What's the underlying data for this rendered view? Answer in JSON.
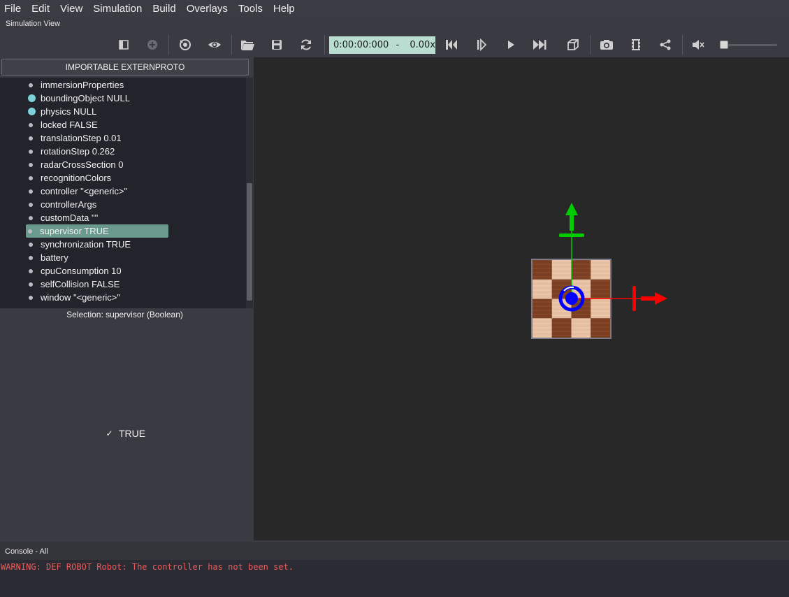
{
  "menu": {
    "items": [
      "File",
      "Edit",
      "View",
      "Simulation",
      "Build",
      "Overlays",
      "Tools",
      "Help"
    ]
  },
  "panel_title": "Simulation View",
  "toolbar": {
    "time": "0:00:00:000",
    "speed_separator": "-",
    "speed": "0.00x",
    "icons": [
      "toggle-panel-icon",
      "add-node-icon",
      "reset-view-icon",
      "eye-icon",
      "open-folder-icon",
      "save-icon",
      "reload-icon",
      "step-back-icon",
      "step-icon",
      "play-icon",
      "fast-forward-icon",
      "cube-view-icon",
      "screenshot-icon",
      "movie-icon",
      "share-icon",
      "mute-icon"
    ],
    "volume_level": 0.0
  },
  "scene_tree": {
    "importable_button": "IMPORTABLE EXTERNPROTO",
    "rows": [
      {
        "label": "immersionProperties",
        "type": "field"
      },
      {
        "label": "boundingObject NULL",
        "type": "node"
      },
      {
        "label": "physics NULL",
        "type": "node"
      },
      {
        "label": "locked FALSE",
        "type": "field"
      },
      {
        "label": "translationStep 0.01",
        "type": "field"
      },
      {
        "label": "rotationStep 0.262",
        "type": "field"
      },
      {
        "label": "radarCrossSection 0",
        "type": "field"
      },
      {
        "label": "recognitionColors",
        "type": "field"
      },
      {
        "label": "controller \"<generic>\"",
        "type": "field"
      },
      {
        "label": "controllerArgs",
        "type": "field"
      },
      {
        "label": "customData \"\"",
        "type": "field"
      },
      {
        "label": "supervisor TRUE",
        "type": "field",
        "selected": true
      },
      {
        "label": "synchronization TRUE",
        "type": "field"
      },
      {
        "label": "battery",
        "type": "field"
      },
      {
        "label": "cpuConsumption 10",
        "type": "field"
      },
      {
        "label": "selfCollision FALSE",
        "type": "field"
      },
      {
        "label": "window \"<generic>\"",
        "type": "field"
      }
    ]
  },
  "field_editor": {
    "selection": "Selection: supervisor (Boolean)",
    "checkbox_mark": "✓",
    "checkbox_label": "TRUE"
  },
  "console": {
    "title": "Console - All",
    "lines": [
      "WARNING: DEF ROBOT Robot: The controller has not been set."
    ]
  },
  "colors": {
    "accent_selected": "#6a9a8c",
    "time_box": "#b9ddd0",
    "warning": "#ee5b5b",
    "axis_x": "#ff0000",
    "axis_y": "#00cc00",
    "axis_z": "#0000ff"
  }
}
